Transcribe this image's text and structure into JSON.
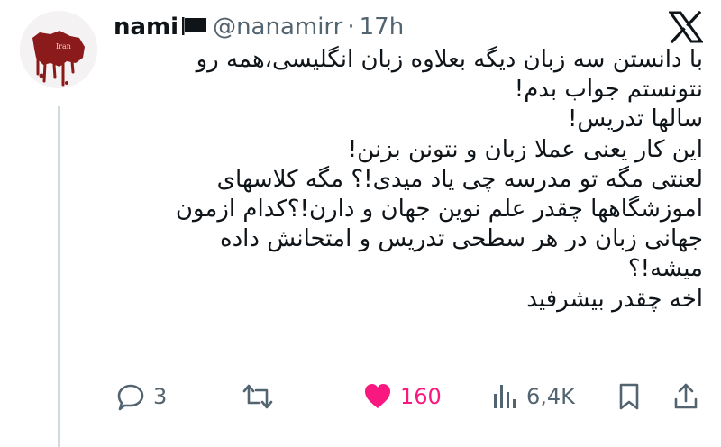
{
  "tweet": {
    "author_name": "nami",
    "handle": "@nanamirr",
    "separator": "·",
    "time": "17h",
    "lines": [
      "با دانستن سه زبان دیگه بعلاوه زبان انگلیسی،همه رو",
      "نتونستم جواب بدم!",
      "سالها تدریس!",
      "این کار یعنی عملا زبان و نتونن بزنن!",
      "لعنتی مگه تو مدرسه چی یاد میدی!؟ مگه کلاسهای",
      "اموزشگاهها چقدر علم نوین جهان و دارن!؟کدام ازمون",
      "جهانی زبان در هر سطحی تدریس و امتحانش داده",
      "میشه!؟",
      "اخه چقدر بیشرفید"
    ]
  },
  "avatar": {
    "caption": "Iran"
  },
  "actions": {
    "replies": "3",
    "retweets": "",
    "likes": "160",
    "views": "6,4K"
  },
  "colors": {
    "text": "#0f1419",
    "muted": "#536471",
    "like": "#f91880",
    "thread_line": "#cfd9de",
    "avatar_red": "#8b1a1a"
  },
  "icons": [
    "black-flag-icon",
    "x-logo-icon",
    "reply-icon",
    "retweet-icon",
    "heart-icon",
    "views-icon",
    "bookmark-icon",
    "share-icon"
  ]
}
